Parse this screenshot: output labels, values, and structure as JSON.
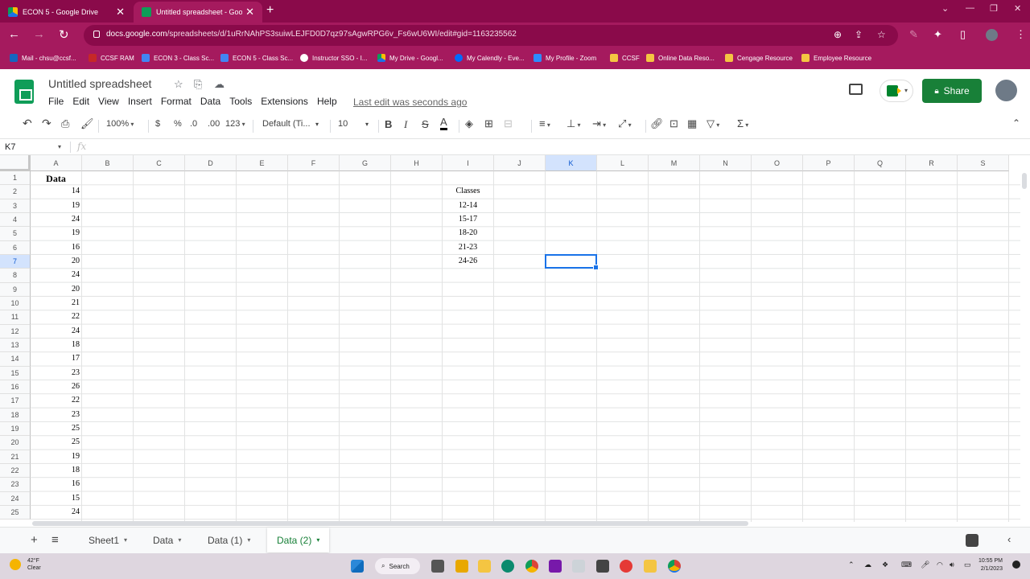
{
  "browser": {
    "tabs": [
      {
        "title": "ECON 5 - Google Drive"
      },
      {
        "title": "Untitled spreadsheet - Google"
      }
    ],
    "address": {
      "host": "docs.google.com",
      "path": "/spreadsheets/d/1uRrNAhPS3suiwLEJFD0D7qz97sAgwRPG6v_Fs6wU6WI/edit#gid=1163235562"
    },
    "bookmarks": [
      "Mail - chsu@ccsf...",
      "CCSF RAM",
      "ECON 3 - Class Sc...",
      "ECON 5 - Class Sc...",
      "Instructor SSO - I...",
      "My Drive - Googl...",
      "My Calendly - Eve...",
      "My Profile - Zoom",
      "CCSF",
      "Online Data Reso...",
      "Cengage Resource",
      "Employee Resource"
    ],
    "colors": {
      "frame": "#8a0a4a",
      "toolbar": "#a51a5e"
    }
  },
  "sheets": {
    "title": "Untitled spreadsheet",
    "menu": [
      "File",
      "Edit",
      "View",
      "Insert",
      "Format",
      "Data",
      "Tools",
      "Extensions",
      "Help"
    ],
    "last_edit": "Last edit was seconds ago",
    "share_label": "Share",
    "toolbar": {
      "zoom": "100%",
      "currency": "$",
      "percent": "%",
      "dec_less": ".0",
      "dec_more": ".00",
      "format_more": "123",
      "font": "Default (Ti...",
      "font_size": "10"
    },
    "name_box": "K7",
    "fx": "fx",
    "columns": [
      "A",
      "B",
      "C",
      "D",
      "E",
      "F",
      "G",
      "H",
      "I",
      "J",
      "K",
      "L",
      "M",
      "N",
      "O",
      "P",
      "Q",
      "R",
      "S"
    ],
    "rows": [
      "1",
      "2",
      "3",
      "4",
      "5",
      "6",
      "7",
      "8",
      "9",
      "10",
      "11",
      "12",
      "13",
      "14",
      "15",
      "16",
      "17",
      "18",
      "19",
      "20",
      "21",
      "22",
      "23",
      "24",
      "25"
    ],
    "selected_cell": {
      "col": "K",
      "row": "7"
    },
    "column_a": {
      "header": "Data",
      "values": [
        "14",
        "19",
        "24",
        "19",
        "16",
        "20",
        "24",
        "20",
        "21",
        "22",
        "24",
        "18",
        "17",
        "23",
        "26",
        "22",
        "23",
        "25",
        "25",
        "19",
        "18",
        "16",
        "15",
        "24"
      ]
    },
    "column_i": {
      "header": "Classes",
      "values": [
        "12-14",
        "15-17",
        "18-20",
        "21-23",
        "24-26"
      ]
    },
    "sheet_tabs": [
      "Sheet1",
      "Data",
      "Data (1)",
      "Data (2)"
    ],
    "active_tab": "Data (2)"
  },
  "taskbar": {
    "temp": "42°F",
    "condition": "Clear",
    "search_label": "Search",
    "time": "10:55 PM",
    "date": "2/1/2023"
  }
}
